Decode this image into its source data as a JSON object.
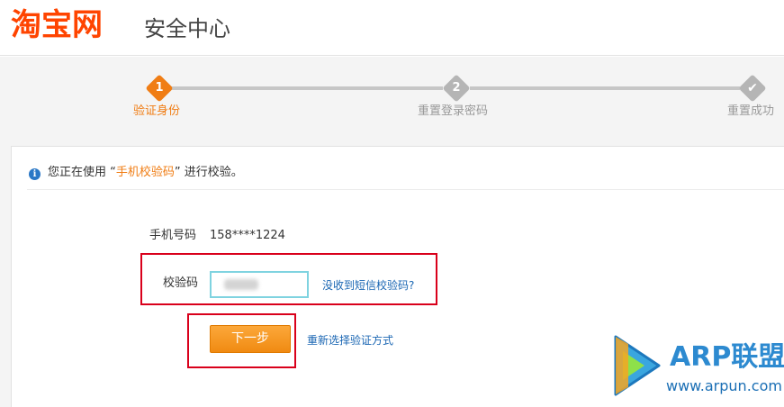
{
  "header": {
    "logo_text": "淘宝网",
    "title": "安全中心"
  },
  "steps": [
    {
      "number": "1",
      "label": "验证身份",
      "state": "active",
      "color": "#f07d14"
    },
    {
      "number": "2",
      "label": "重置登录密码",
      "state": "pending",
      "color": "#b5b5b5"
    },
    {
      "number": "✔",
      "label": "重置成功",
      "state": "pending",
      "color": "#b5b5b5",
      "icon": "check-icon"
    }
  ],
  "notice": {
    "icon": "info-icon",
    "prefix": "您正在使用 “",
    "highlight": "手机校验码",
    "suffix": "” 进行校验。"
  },
  "form": {
    "phone_label": "手机号码",
    "phone_value": "158****1224",
    "code_label": "校验码",
    "code_value": "",
    "no_code_link": "没收到短信校验码?",
    "next_button": "下一步",
    "reselect_link": "重新选择验证方式"
  },
  "watermark": {
    "brand": "ARP联盟",
    "url": "www.arpun.com"
  },
  "colors": {
    "brand_orange": "#ff4400",
    "step_active": "#f07d14",
    "link_blue": "#1a66b3",
    "highlight_red": "#d9001b"
  }
}
